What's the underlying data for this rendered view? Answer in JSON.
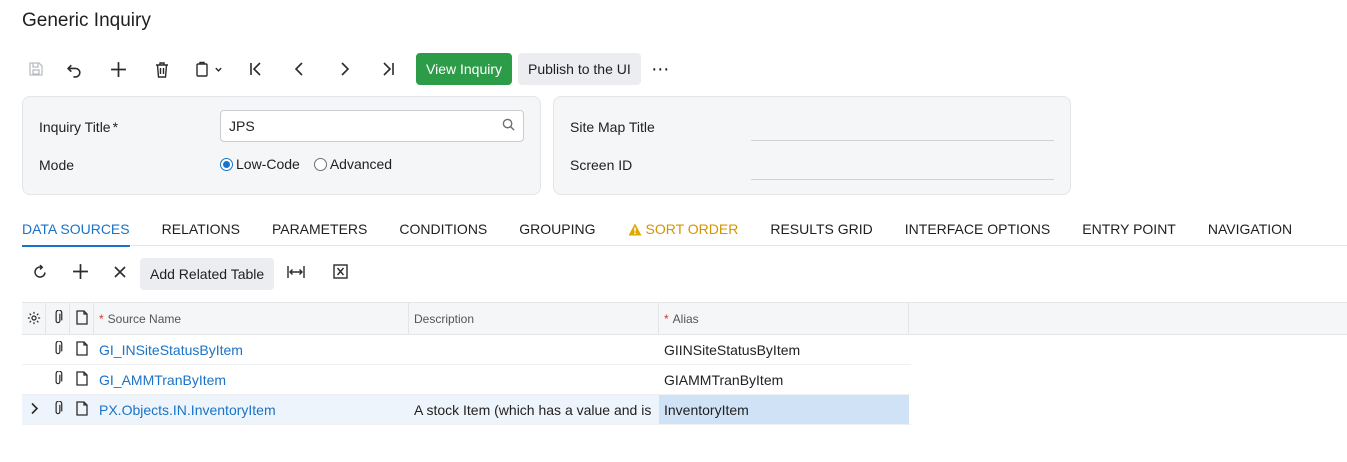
{
  "page": {
    "title": "Generic Inquiry"
  },
  "toolbar": {
    "save_icon": "save-icon",
    "undo_icon": "undo-icon",
    "add_icon": "plus-icon",
    "delete_icon": "trash-icon",
    "copy_icon": "clipboard-icon",
    "first_icon": "first-record-icon",
    "prev_icon": "previous-icon",
    "next_icon": "next-icon",
    "last_icon": "last-record-icon",
    "view_inquiry_label": "View Inquiry",
    "publish_label": "Publish to the UI",
    "more_label": "⋯",
    "primary_color": "#2d9c48"
  },
  "form": {
    "inquiry_title_label": "Inquiry Title",
    "inquiry_title_required": "*",
    "inquiry_title_value": "JPS",
    "mode_label": "Mode",
    "mode_options": [
      "Low-Code",
      "Advanced"
    ],
    "mode_selected": "Low-Code",
    "site_map_title_label": "Site Map Title",
    "site_map_title_value": "",
    "screen_id_label": "Screen ID",
    "screen_id_value": ""
  },
  "tabs": [
    {
      "label": "DATA SOURCES",
      "active": true
    },
    {
      "label": "RELATIONS"
    },
    {
      "label": "PARAMETERS"
    },
    {
      "label": "CONDITIONS"
    },
    {
      "label": "GROUPING"
    },
    {
      "label": "SORT ORDER",
      "warning": true
    },
    {
      "label": "RESULTS GRID"
    },
    {
      "label": "INTERFACE OPTIONS"
    },
    {
      "label": "ENTRY POINT"
    },
    {
      "label": "NAVIGATION"
    }
  ],
  "grid_toolbar": {
    "refresh_icon": "refresh-icon",
    "add_icon": "plus-icon",
    "delete_icon": "close-icon",
    "add_related_label": "Add Related Table",
    "fit_icon": "fit-columns-icon",
    "excel_icon": "excel-export-icon"
  },
  "grid": {
    "columns": {
      "source_name": "Source Name",
      "description": "Description",
      "alias": "Alias",
      "required_marker": "*"
    },
    "rows": [
      {
        "source_name": "GI_INSiteStatusByItem",
        "description": "",
        "alias": "GIINSiteStatusByItem"
      },
      {
        "source_name": "GI_AMMTranByItem",
        "description": "",
        "alias": "GIAMMTranByItem"
      },
      {
        "source_name": "PX.Objects.IN.InventoryItem",
        "description": "A stock Item (which has a value and is",
        "alias": "InventoryItem",
        "selected": true
      }
    ],
    "link_color": "#1a73c7"
  }
}
